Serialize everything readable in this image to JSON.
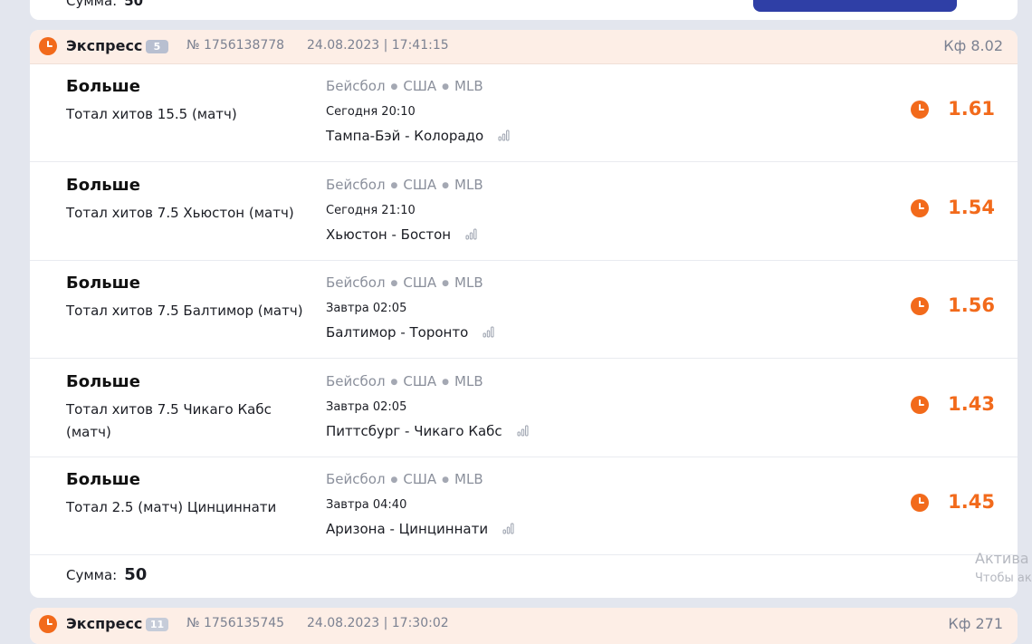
{
  "prev_card": {
    "sum_label": "Сумма:",
    "sum_value": "50"
  },
  "header": {
    "type": "Экспресс",
    "count": "5",
    "number": "№ 1756138778",
    "datetime": "24.08.2023 | 17:41:15",
    "kf": "Кф 8.02"
  },
  "bets": [
    {
      "title": "Больше",
      "market": "Тотал хитов 15.5 (матч)",
      "sport": "Бейсбол",
      "country": "США",
      "league": "MLB",
      "time": "Сегодня 20:10",
      "match": "Тампа-Бэй - Колорадо",
      "odds": "1.61"
    },
    {
      "title": "Больше",
      "market": "Тотал хитов 7.5 Хьюстон (матч)",
      "sport": "Бейсбол",
      "country": "США",
      "league": "MLB",
      "time": "Сегодня 21:10",
      "match": "Хьюстон - Бостон",
      "odds": "1.54"
    },
    {
      "title": "Больше",
      "market": "Тотал хитов 7.5 Балтимор (матч)",
      "sport": "Бейсбол",
      "country": "США",
      "league": "MLB",
      "time": "Завтра 02:05",
      "match": "Балтимор - Торонто",
      "odds": "1.56"
    },
    {
      "title": "Больше",
      "market": "Тотал хитов 7.5 Чикаго Кабс (матч)",
      "sport": "Бейсбол",
      "country": "США",
      "league": "MLB",
      "time": "Завтра 02:05",
      "match": "Питтсбург - Чикаго Кабс",
      "odds": "1.43"
    },
    {
      "title": "Больше",
      "market": "Тотал 2.5 (матч) Цинциннати",
      "sport": "Бейсбол",
      "country": "США",
      "league": "MLB",
      "time": "Завтра 04:40",
      "match": "Аризона - Цинциннати",
      "odds": "1.45"
    }
  ],
  "sum": {
    "label": "Сумма:",
    "value": "50"
  },
  "next_header": {
    "type": "Экспресс",
    "count": "11",
    "number": "№ 1756135745",
    "datetime": "24.08.2023 | 17:30:02",
    "kf": "Кф 271"
  },
  "watermark": {
    "line1": "Актива",
    "line2": "Чтобы ак"
  },
  "colors": {
    "accent": "#f26a1b",
    "header_bg": "#fdeee6",
    "button": "#2f3fa6"
  }
}
